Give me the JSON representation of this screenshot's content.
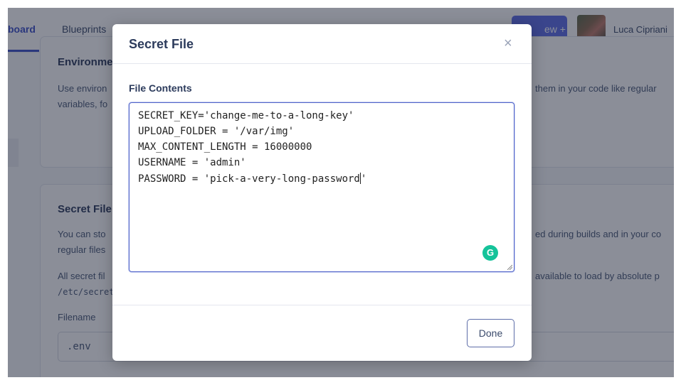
{
  "nav": {
    "tabs": [
      {
        "label": "board",
        "active": true
      },
      {
        "label": "Blueprints",
        "active": false
      }
    ],
    "new_button_label": "ew +",
    "user_name": "Luca Cipriani"
  },
  "background": {
    "env_card": {
      "title": "Environme",
      "text_line1": "Use environ",
      "text_line2": "variables, fo",
      "right_text": "them in your code like regular"
    },
    "secret_card": {
      "title": "Secret File",
      "text_line1": "You can sto",
      "text_line2": "regular files",
      "text_line3": "All secret fil",
      "path_code": "/etc/secret",
      "right_text1": "ed during builds and in your co",
      "right_text2": "available to load by absolute p",
      "filename_label": "Filename",
      "filename_value": ".env"
    }
  },
  "modal": {
    "title": "Secret File",
    "close_icon": "×",
    "file_contents_label": "File Contents",
    "lines": [
      "SECRET_KEY='change-me-to-a-long-key'",
      "UPLOAD_FOLDER = '/var/img'",
      "MAX_CONTENT_LENGTH = 16000000",
      "USERNAME = 'admin'"
    ],
    "last_line_before_caret": "PASSWORD = 'pick-a-very-long-password",
    "last_line_after_caret": "'",
    "grammarly_icon": "G",
    "done_label": "Done"
  },
  "colors": {
    "accent": "#3d50c8",
    "button_primary": "#5d6de6",
    "grammarly": "#15c39a"
  }
}
